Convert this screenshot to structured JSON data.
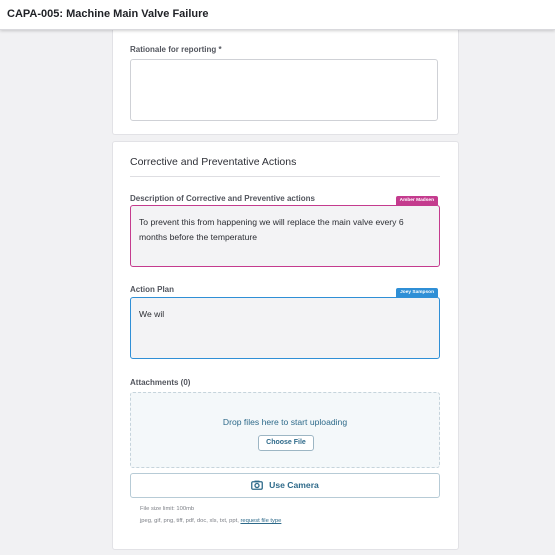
{
  "header": {
    "title": "CAPA-005: Machine Main Valve Failure"
  },
  "rationale": {
    "label": "Rationale for reporting *",
    "value": ""
  },
  "corrective_section": {
    "title": "Corrective and Preventative Actions"
  },
  "description_field": {
    "label": "Description of Corrective and Preventive actions",
    "collaborator": "Amber Madsen",
    "value": "To prevent this from happening we will replace the main valve every 6 months before the temperature"
  },
  "action_plan_field": {
    "label": "Action Plan",
    "collaborator": "Joey Sampson",
    "value": "We wil"
  },
  "attachments": {
    "label": "Attachments (0)",
    "drop_text": "Drop files here to start uploading",
    "choose_file_label": "Choose File",
    "camera_label": "Use Camera",
    "file_size_limit": "File size limit: 100mb",
    "file_types": "jpeg, gif, png, tiff, pdf, doc, xls, txt, ppt,",
    "request_link": "request file type"
  },
  "colors": {
    "collaborator_pink": "#c43b8e",
    "collaborator_blue": "#2f8fd6",
    "accent": "#2e6a8a"
  },
  "icons": {
    "camera": "camera-icon"
  }
}
